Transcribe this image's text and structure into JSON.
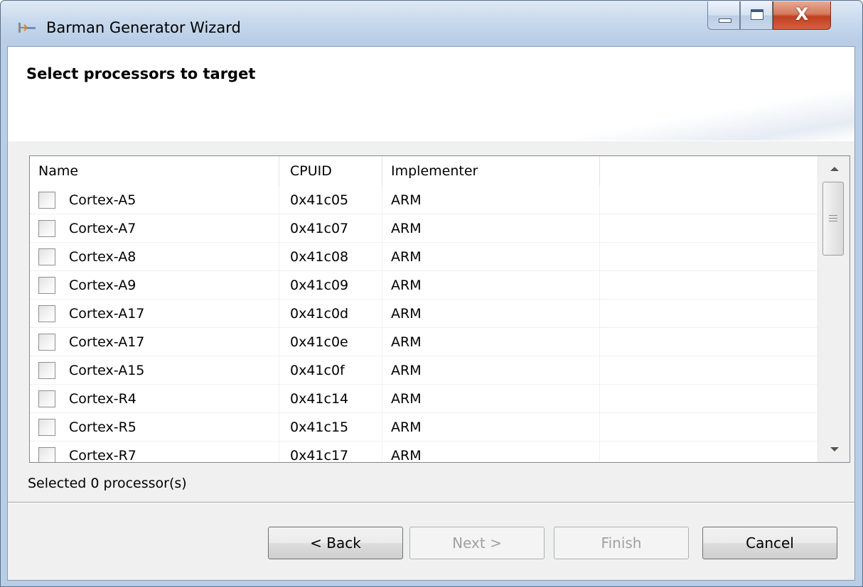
{
  "window": {
    "title": "Barman Generator Wizard",
    "close_glyph": "X"
  },
  "banner": {
    "title": "Select processors to target"
  },
  "table": {
    "headers": [
      "Name",
      "CPUID",
      "Implementer"
    ],
    "rows": [
      {
        "name": "Cortex-A5",
        "cpuid": "0x41c05",
        "implementer": "ARM",
        "checked": false
      },
      {
        "name": "Cortex-A7",
        "cpuid": "0x41c07",
        "implementer": "ARM",
        "checked": false
      },
      {
        "name": "Cortex-A8",
        "cpuid": "0x41c08",
        "implementer": "ARM",
        "checked": false
      },
      {
        "name": "Cortex-A9",
        "cpuid": "0x41c09",
        "implementer": "ARM",
        "checked": false
      },
      {
        "name": "Cortex-A17",
        "cpuid": "0x41c0d",
        "implementer": "ARM",
        "checked": false
      },
      {
        "name": "Cortex-A17",
        "cpuid": "0x41c0e",
        "implementer": "ARM",
        "checked": false
      },
      {
        "name": "Cortex-A15",
        "cpuid": "0x41c0f",
        "implementer": "ARM",
        "checked": false
      },
      {
        "name": "Cortex-R4",
        "cpuid": "0x41c14",
        "implementer": "ARM",
        "checked": false
      },
      {
        "name": "Cortex-R5",
        "cpuid": "0x41c15",
        "implementer": "ARM",
        "checked": false
      },
      {
        "name": "Cortex-R7",
        "cpuid": "0x41c17",
        "implementer": "ARM",
        "checked": false
      }
    ]
  },
  "status": {
    "text": "Selected 0 processor(s)"
  },
  "buttons": {
    "back": "< Back",
    "next": "Next >",
    "finish": "Finish",
    "cancel": "Cancel"
  },
  "colors": {
    "title_bar": "#c5d7ec",
    "close_button": "#c0401f",
    "dialog_background": "#f0f0f0",
    "disabled_text": "#a0a0a0"
  },
  "icons": {
    "app": "wizard-app-icon",
    "minimize": "minimize-icon",
    "maximize": "maximize-icon",
    "close": "close-icon"
  }
}
